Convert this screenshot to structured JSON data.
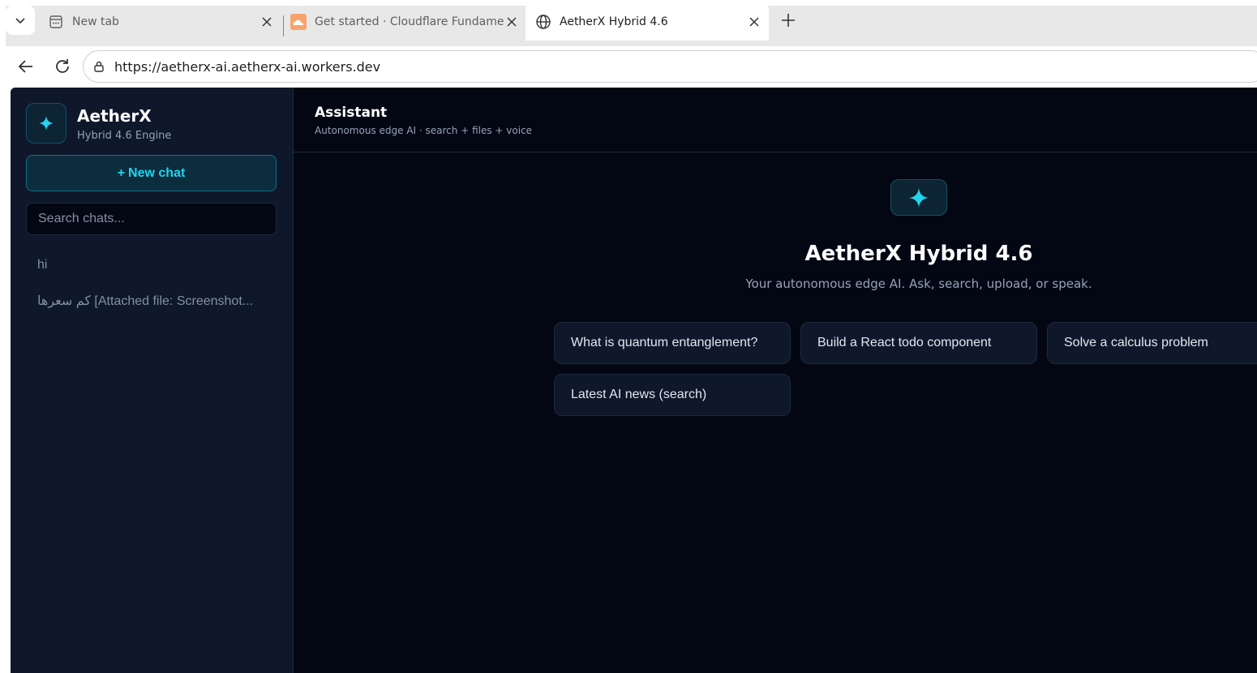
{
  "browser": {
    "tabs": [
      {
        "label": "New tab",
        "icon": "new-tab-page-icon"
      },
      {
        "label": "Get started · Cloudflare Fundamentals",
        "icon": "cloudflare-icon"
      },
      {
        "label": "AetherX Hybrid 4.6",
        "icon": "globe-icon"
      }
    ],
    "address": {
      "url": "https://aetherx-ai.aetherx-ai.workers.dev"
    }
  },
  "sidebar": {
    "brand": {
      "title": "AetherX",
      "subtitle": "Hybrid 4.6 Engine"
    },
    "new_chat_label": "New chat",
    "new_chat_icon": "+",
    "search": {
      "placeholder": "Search chats..."
    },
    "history": [
      {
        "label": "hi"
      },
      {
        "label": "كم سعرها [Attached file: Screenshot..."
      }
    ]
  },
  "main": {
    "header": {
      "title": "Assistant",
      "subtitle": "Autonomous edge AI · search + files + voice"
    },
    "hero": {
      "title": "AetherX Hybrid 4.6",
      "subtitle": "Your autonomous edge AI. Ask, search, upload, or speak."
    },
    "suggestions": [
      {
        "label": "What is quantum entanglement?"
      },
      {
        "label": "Build a React todo component"
      },
      {
        "label": "Solve a calculus problem"
      },
      {
        "label": "Latest AI news (search)"
      }
    ]
  },
  "colors": {
    "accent": "#22d3ee",
    "background": "#030713",
    "sidebar": "#0f172a",
    "border": "#1e293b"
  }
}
